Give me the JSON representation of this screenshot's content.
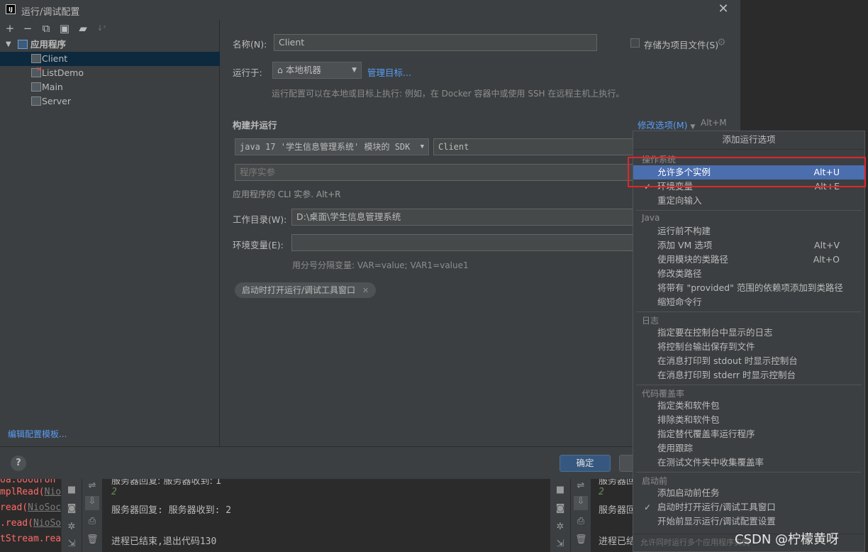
{
  "window": {
    "title": "运行/调试配置",
    "app_icon": "IJ"
  },
  "left_toolbar": {
    "icons": [
      "add-icon",
      "remove-icon",
      "copy-icon",
      "save-icon",
      "folder-add-icon",
      "sort-icon"
    ]
  },
  "tree": {
    "root": "应用程序",
    "items": [
      {
        "label": "Client",
        "selected": true,
        "error": false
      },
      {
        "label": "ListDemo",
        "selected": false,
        "error": true
      },
      {
        "label": "Main",
        "selected": false,
        "error": false
      },
      {
        "label": "Server",
        "selected": false,
        "error": false
      }
    ]
  },
  "edit_templates_link": "编辑配置模板...",
  "form": {
    "name_label": "名称(N):",
    "name_value": "Client",
    "store_as_project_file": "存储为项目文件(S)",
    "run_on_label": "运行于:",
    "run_on_value": "本地机器",
    "manage_targets": "管理目标...",
    "run_on_hint": "运行配置可以在本地或目标上执行: 例如，在 Docker 容器中或使用 SSH 在远程主机上执行。",
    "build_run_title": "构建并运行",
    "modify_options": "修改选项(M)",
    "modify_options_shortcut": "Alt+M",
    "sdk_value": "java 17 '学生信息管理系统' 模块的 SDK",
    "main_class_value": "Client",
    "program_args_placeholder": "程序实参",
    "cli_hint": "应用程序的 CLI 实参. Alt+R",
    "workdir_label": "工作目录(W):",
    "workdir_value": "D:\\桌面\\学生信息管理系统",
    "env_label": "环境变量(E):",
    "env_value": "",
    "env_hint": "用分号分隔变量: VAR=value; VAR1=value1",
    "chip_label": "启动时打开运行/调试工具窗口"
  },
  "buttons": {
    "help": "?",
    "ok": "确定"
  },
  "popup": {
    "title": "添加运行选项",
    "groups": [
      {
        "title": "操作系统",
        "items": [
          {
            "label": "允许多个实例",
            "shortcut": "Alt+U",
            "checked": false,
            "highlighted": true
          },
          {
            "label": "环境变量",
            "shortcut": "Alt+E",
            "checked": true,
            "highlighted": false
          },
          {
            "label": "重定向输入",
            "shortcut": "",
            "checked": false,
            "highlighted": false
          }
        ]
      },
      {
        "title": "Java",
        "items": [
          {
            "label": "运行前不构建",
            "shortcut": "",
            "checked": false,
            "highlighted": false
          },
          {
            "label": "添加 VM 选项",
            "shortcut": "Alt+V",
            "checked": false,
            "highlighted": false
          },
          {
            "label": "使用模块的类路径",
            "shortcut": "Alt+O",
            "checked": false,
            "highlighted": false
          },
          {
            "label": "修改类路径",
            "shortcut": "",
            "checked": false,
            "highlighted": false
          },
          {
            "label": "将带有 \"provided\" 范围的依赖项添加到类路径",
            "shortcut": "",
            "checked": false,
            "highlighted": false
          },
          {
            "label": "缩短命令行",
            "shortcut": "",
            "checked": false,
            "highlighted": false
          }
        ]
      },
      {
        "title": "日志",
        "items": [
          {
            "label": "指定要在控制台中显示的日志",
            "shortcut": "",
            "checked": false,
            "highlighted": false
          },
          {
            "label": "将控制台输出保存到文件",
            "shortcut": "",
            "checked": false,
            "highlighted": false
          },
          {
            "label": "在消息打印到 stdout 时显示控制台",
            "shortcut": "",
            "checked": false,
            "highlighted": false
          },
          {
            "label": "在消息打印到 stderr 时显示控制台",
            "shortcut": "",
            "checked": false,
            "highlighted": false
          }
        ]
      },
      {
        "title": "代码覆盖率",
        "items": [
          {
            "label": "指定类和软件包",
            "shortcut": "",
            "checked": false,
            "highlighted": false
          },
          {
            "label": "排除类和软件包",
            "shortcut": "",
            "checked": false,
            "highlighted": false
          },
          {
            "label": "指定替代覆盖率运行程序",
            "shortcut": "",
            "checked": false,
            "highlighted": false
          },
          {
            "label": "使用跟踪",
            "shortcut": "",
            "checked": false,
            "highlighted": false
          },
          {
            "label": "在测试文件夹中收集覆盖率",
            "shortcut": "",
            "checked": false,
            "highlighted": false
          }
        ]
      },
      {
        "title": "启动前",
        "items": [
          {
            "label": "添加启动前任务",
            "shortcut": "",
            "checked": false,
            "highlighted": false
          },
          {
            "label": "启动时打开运行/调试工具窗口",
            "shortcut": "",
            "checked": true,
            "highlighted": false
          },
          {
            "label": "开始前显示运行/调试配置设置",
            "shortcut": "",
            "checked": false,
            "highlighted": false
          }
        ]
      }
    ],
    "footer": "允许同时运行多个应用程序实例"
  },
  "background": {
    "code_lines": [
      {
        "prefix": "mplRead(",
        "link": "Nio"
      },
      {
        "prefix": "read(",
        "link": "NioSock"
      },
      {
        "prefix": ".read(",
        "link": "NioSo"
      },
      {
        "prefix": "tStream.rea",
        "link": ""
      }
    ],
    "console_left": {
      "line1": "服务器回复: 服务器收到: 1",
      "number": "2",
      "line2": "服务器回复: 服务器收到: 2",
      "exit": "进程已结束,退出代码130"
    },
    "console_right": {
      "line1": "服务器回",
      "number": "2",
      "line2": "服务器回",
      "exit": "进程已结"
    }
  },
  "watermark": "CSDN @柠檬黄呀"
}
